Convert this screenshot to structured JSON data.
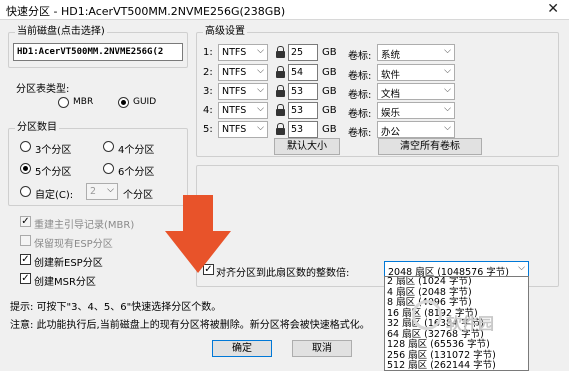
{
  "window": {
    "title": "快速分区 - HD1:AcerVT500MM.2NVME256G(238GB)",
    "close": "✕"
  },
  "disk": {
    "legend": "当前磁盘(点击选择)",
    "value": "HD1:AcerVT500MM.2NVME256G(2"
  },
  "partition_type": {
    "legend": "分区表类型:",
    "options": [
      "MBR",
      "GUID"
    ],
    "selected": "GUID"
  },
  "partition_count": {
    "legend": "分区数目",
    "options": [
      "3个分区",
      "4个分区",
      "5个分区",
      "6个分区"
    ],
    "selected": "5个分区",
    "custom_label": "自定(C):",
    "custom_value": "2",
    "custom_suffix": "个分区"
  },
  "options": [
    {
      "label": "重建主引导记录(MBR)",
      "checked": true,
      "disabled": true
    },
    {
      "label": "保留现有ESP分区",
      "checked": false,
      "disabled": true
    },
    {
      "label": "创建新ESP分区",
      "checked": true,
      "disabled": false
    },
    {
      "label": "创建MSR分区",
      "checked": true,
      "disabled": false
    }
  ],
  "advanced": {
    "legend": "高级设置",
    "unit": "GB",
    "volume_label": "卷标:",
    "rows": [
      {
        "index": "1:",
        "fs": "NTFS",
        "size": "25",
        "label": "系统"
      },
      {
        "index": "2:",
        "fs": "NTFS",
        "size": "54",
        "label": "软件"
      },
      {
        "index": "3:",
        "fs": "NTFS",
        "size": "53",
        "label": "文档"
      },
      {
        "index": "4:",
        "fs": "NTFS",
        "size": "53",
        "label": "娱乐"
      },
      {
        "index": "5:",
        "fs": "NTFS",
        "size": "53",
        "label": "办公"
      }
    ],
    "default_size_button": "默认大小",
    "clear_labels_button": "清空所有卷标"
  },
  "align": {
    "label": "对齐分区到此扇区数的整数倍:",
    "checked": true,
    "selected": "2048 扇区 (1048576 字节)",
    "list": [
      "2 扇区 (1024 字节)",
      "4 扇区 (2048 字节)",
      "8 扇区 (4096 字节)",
      "16 扇区 (8192 字节)",
      "32 扇区 (16384 字节)",
      "64 扇区 (32768 字节)",
      "128 扇区 (65536 字节)",
      "256 扇区 (131072 字节)",
      "512 扇区 (262144 字节)"
    ]
  },
  "hints": {
    "tip": "提示: 可按下\"3、4、5、6\"快速选择分区个数。",
    "warning": "注意: 此功能执行后,当前磁盘上的现有分区将被删除。新分区将会被快速格式化。"
  },
  "buttons": {
    "ok": "确定",
    "cancel": "取消"
  },
  "watermark": "软件园",
  "colors": {
    "arrow": "#e8532a",
    "accent": "#0078d7"
  }
}
